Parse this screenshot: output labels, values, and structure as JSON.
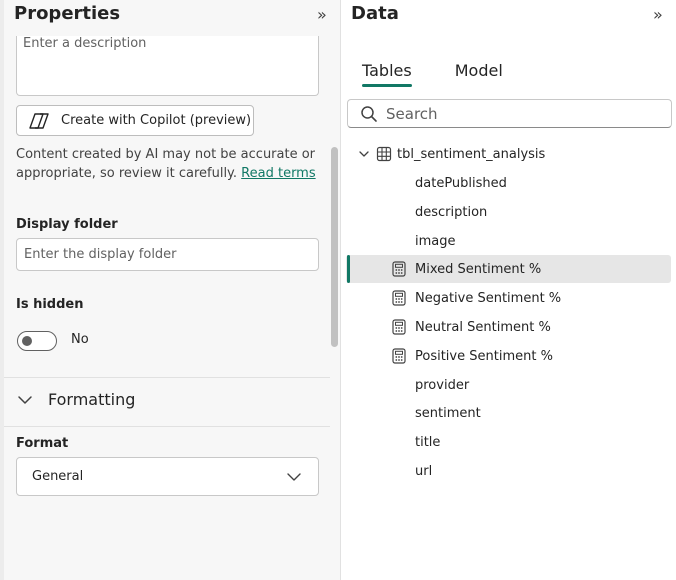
{
  "properties": {
    "title": "Properties",
    "collapse_glyph": "»",
    "description_placeholder": "Enter a description",
    "copilot_button": "Create with Copilot (preview)",
    "ai_note": "Content created by AI may not be accurate or appropriate, so review it carefully.",
    "ai_note_link": "Read terms",
    "display_folder_label": "Display folder",
    "display_folder_placeholder": "Enter the display folder",
    "is_hidden_label": "Is hidden",
    "is_hidden_value": "No",
    "formatting_label": "Formatting",
    "format_label": "Format",
    "format_value": "General"
  },
  "data_pane": {
    "title": "Data",
    "collapse_glyph": "»",
    "tabs": [
      {
        "label": "Tables",
        "active": true
      },
      {
        "label": "Model",
        "active": false
      }
    ],
    "search_placeholder": "Search",
    "table_name": "tbl_sentiment_analysis",
    "fields": [
      {
        "label": "datePublished",
        "icon": "none"
      },
      {
        "label": "description",
        "icon": "none"
      },
      {
        "label": "image",
        "icon": "none"
      },
      {
        "label": "Mixed Sentiment %",
        "icon": "calculator-icon",
        "selected": true
      },
      {
        "label": "Negative Sentiment %",
        "icon": "calculator-icon"
      },
      {
        "label": "Neutral Sentiment %",
        "icon": "calculator-icon"
      },
      {
        "label": "Positive Sentiment %",
        "icon": "calculator-icon"
      },
      {
        "label": "provider",
        "icon": "none"
      },
      {
        "label": "sentiment",
        "icon": "none"
      },
      {
        "label": "title",
        "icon": "none"
      },
      {
        "label": "url",
        "icon": "none"
      }
    ]
  },
  "colors": {
    "accent": "#117865",
    "selected_row": "#e6e6e6",
    "pane_background": "#f7f7f7"
  }
}
